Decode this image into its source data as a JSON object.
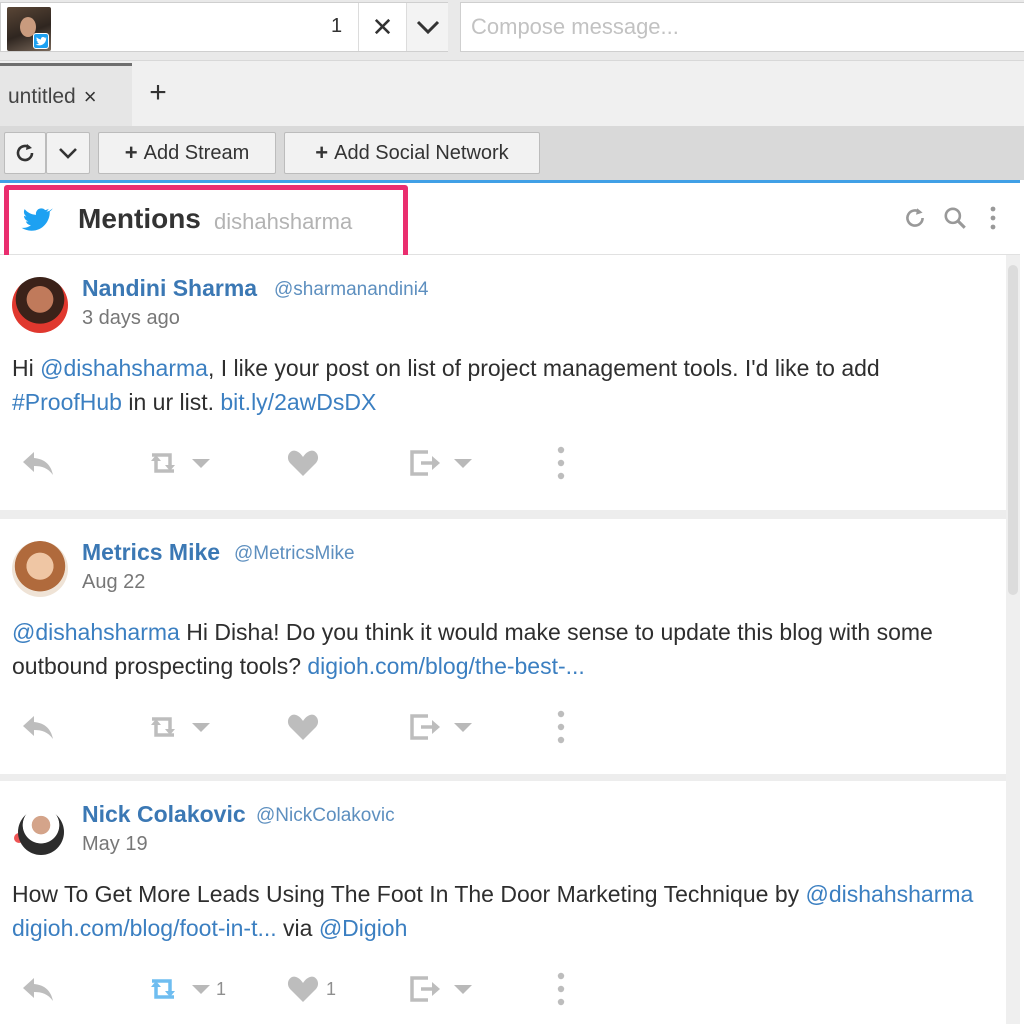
{
  "topbar": {
    "selected_count": "1",
    "compose_placeholder": "Compose message..."
  },
  "tabs": [
    {
      "label": "untitled",
      "close": "×"
    }
  ],
  "tab_add": "+",
  "toolbar": {
    "add_stream": "Add Stream",
    "add_network": "Add Social Network"
  },
  "stream": {
    "title": "Mentions",
    "handle": "dishahsharma"
  },
  "tweets": [
    {
      "name": "Nandini Sharma",
      "handle": "@sharmanandini4",
      "time": "3 days ago",
      "text_parts": [
        "Hi ",
        "@dishahsharma",
        ", I like your post on list of project management tools. I'd like to add ",
        "#ProofHub",
        " in ur list. ",
        "bit.ly/2awDsDX"
      ],
      "retweet_count": "",
      "like_count": ""
    },
    {
      "name": "Metrics Mike",
      "handle": "@MetricsMike",
      "time": "Aug 22",
      "text_parts": [
        "@dishahsharma",
        " Hi Disha! Do you think it would make sense to update this blog with some outbound prospecting tools? ",
        "digioh.com/blog/the-best-..."
      ],
      "retweet_count": "",
      "like_count": ""
    },
    {
      "name": "Nick Colakovic",
      "handle": "@NickColakovic",
      "time": "May 19",
      "text_parts": [
        "How To Get More Leads Using The Foot In The Door Marketing Technique by ",
        "@dishahsharma",
        " ",
        "digioh.com/blog/foot-in-t...",
        " via ",
        "@Digioh"
      ],
      "retweet_count": "1",
      "like_count": "1"
    }
  ],
  "colors": {
    "highlight": "#ea2e6f",
    "link": "#3b7fc1",
    "twitter": "#1da1f2",
    "retweet_active": "#1da1f2"
  },
  "icons": [
    "twitter-icon",
    "close-icon",
    "chevron-down-icon",
    "plus-icon",
    "refresh-icon",
    "search-icon",
    "more-vertical-icon",
    "reply-icon",
    "retweet-icon",
    "heart-icon",
    "share-icon"
  ]
}
